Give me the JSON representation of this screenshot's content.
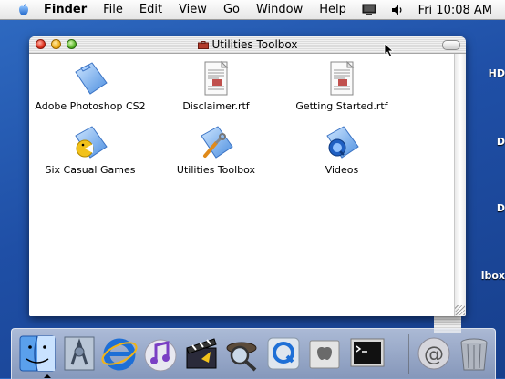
{
  "menubar": {
    "items": [
      "Finder",
      "File",
      "Edit",
      "View",
      "Go",
      "Window",
      "Help"
    ],
    "clock": "Fri 10:08 AM",
    "icons": [
      "apple-icon",
      "display-icon",
      "volume-icon"
    ]
  },
  "desktop": {
    "labels": [
      "HD",
      "D",
      "D",
      "lbox"
    ]
  },
  "window": {
    "title": "Utilities Toolbox",
    "items": [
      {
        "label": "Adobe Photoshop CS2",
        "icon": "folder-icon"
      },
      {
        "label": "Disclaimer.rtf",
        "icon": "document-icon"
      },
      {
        "label": "Getting Started.rtf",
        "icon": "document-icon"
      },
      {
        "label": "Six Casual Games",
        "icon": "games-folder-icon"
      },
      {
        "label": "Utilities Toolbox",
        "icon": "utilities-folder-icon"
      },
      {
        "label": "Videos",
        "icon": "videos-folder-icon"
      }
    ]
  },
  "dock": {
    "items": [
      "finder-icon",
      "system-preferences-icon",
      "internet-explorer-icon",
      "itunes-icon",
      "imovie-icon",
      "sherlock-icon",
      "quicktime-icon",
      "about-mac-icon",
      "terminal-icon",
      "mail-icon",
      "trash-icon"
    ]
  }
}
